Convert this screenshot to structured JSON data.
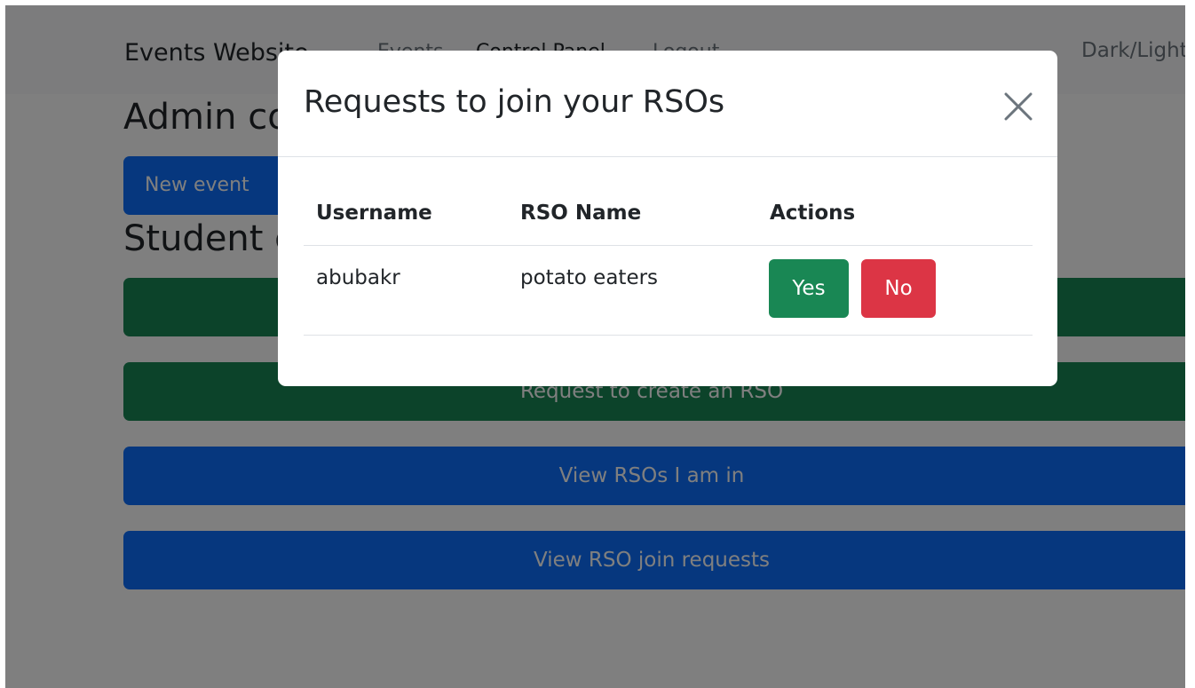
{
  "navbar": {
    "brand": "Events Website",
    "links": {
      "events": "Events",
      "control_panel": "Control Panel",
      "logout": "Logout"
    },
    "theme_toggle": "Dark/Light"
  },
  "main": {
    "admin_heading": "Admin controls",
    "new_event_label": "New event",
    "student_heading": "Student controls",
    "buttons": [
      "",
      "Request to create an RSO",
      "View RSOs I am in",
      "View RSO join requests"
    ]
  },
  "modal": {
    "title": "Requests to join your RSOs",
    "columns": {
      "username": "Username",
      "rso_name": "RSO Name",
      "actions": "Actions"
    },
    "rows": [
      {
        "username": "abubakr",
        "rso_name": "potato eaters",
        "yes_label": "Yes",
        "no_label": "No"
      }
    ]
  },
  "colors": {
    "primary": "#0d6efd",
    "success": "#198754",
    "danger": "#dc3545",
    "backdrop": "rgba(0,0,0,0.5)"
  },
  "icons": {
    "close": "close-icon"
  }
}
